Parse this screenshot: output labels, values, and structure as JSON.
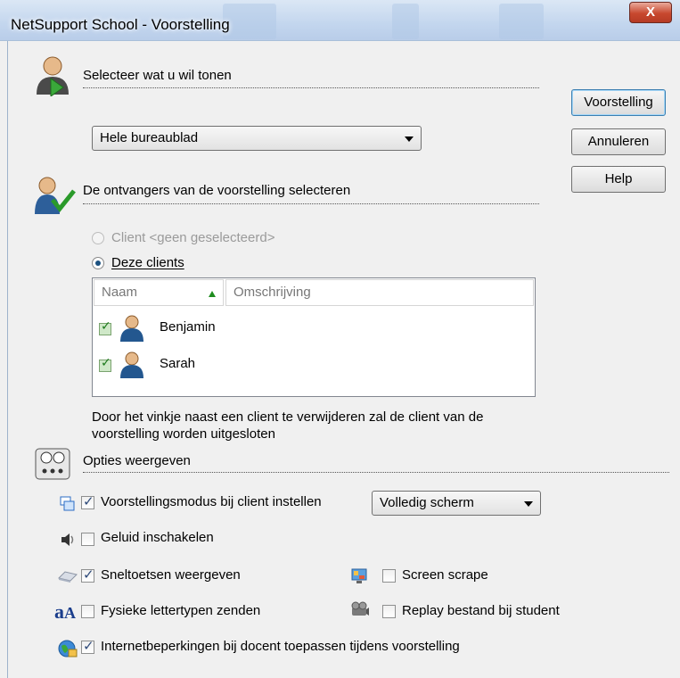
{
  "window": {
    "title": "NetSupport School - Voorstelling",
    "close_glyph": "X"
  },
  "sections": {
    "show": {
      "heading": "Selecteer wat u wil tonen",
      "icon": "presenter-icon"
    },
    "recipients": {
      "heading": "De ontvangers van de voorstelling selecteren",
      "icon": "users-check-icon"
    },
    "options": {
      "heading": "Opties weergeven",
      "icon": "options-panel-icon"
    }
  },
  "show_select": {
    "value": "Hele bureaublad"
  },
  "buttons": {
    "show": "Voorstelling",
    "cancel": "Annuleren",
    "help": "Help"
  },
  "recipients": {
    "radio_client": {
      "label": "Client <geen geselecteerd>",
      "checked": false,
      "disabled": true
    },
    "radio_these": {
      "label": "Deze clients",
      "checked": true
    },
    "columns": {
      "name": "Naam",
      "description": "Omschrijving"
    },
    "clients": [
      {
        "name": "Benjamin",
        "checked": true
      },
      {
        "name": "Sarah",
        "checked": true
      }
    ],
    "note_line1": "Door het vinkje naast een client te verwijderen zal de client van de",
    "note_line2": "voorstelling worden uitgesloten"
  },
  "options": {
    "mode": {
      "label": "Voorstellingsmodus bij client instellen",
      "checked": true,
      "select_value": "Volledig scherm",
      "icon": "windows-icon"
    },
    "sound": {
      "label": "Geluid inschakelen",
      "checked": false,
      "icon": "speaker-icon"
    },
    "shortcuts": {
      "label": "Sneltoetsen weergeven",
      "checked": true,
      "icon": "keyboard-icon"
    },
    "scrape": {
      "label": "Screen scrape",
      "checked": false,
      "icon": "monitor-icon"
    },
    "fonts": {
      "label": "Fysieke lettertypen zenden",
      "checked": false,
      "icon": "font-icon"
    },
    "replay": {
      "label": "Replay bestand bij student",
      "checked": false,
      "icon": "projector-icon"
    },
    "internet": {
      "label": "Internetbeperkingen bij docent toepassen tijdens voorstelling",
      "checked": true,
      "icon": "globe-lock-icon"
    }
  },
  "colors": {
    "accent": "#3c7fb1",
    "close": "#c8482f",
    "titlebar": "#c3d6ee"
  }
}
